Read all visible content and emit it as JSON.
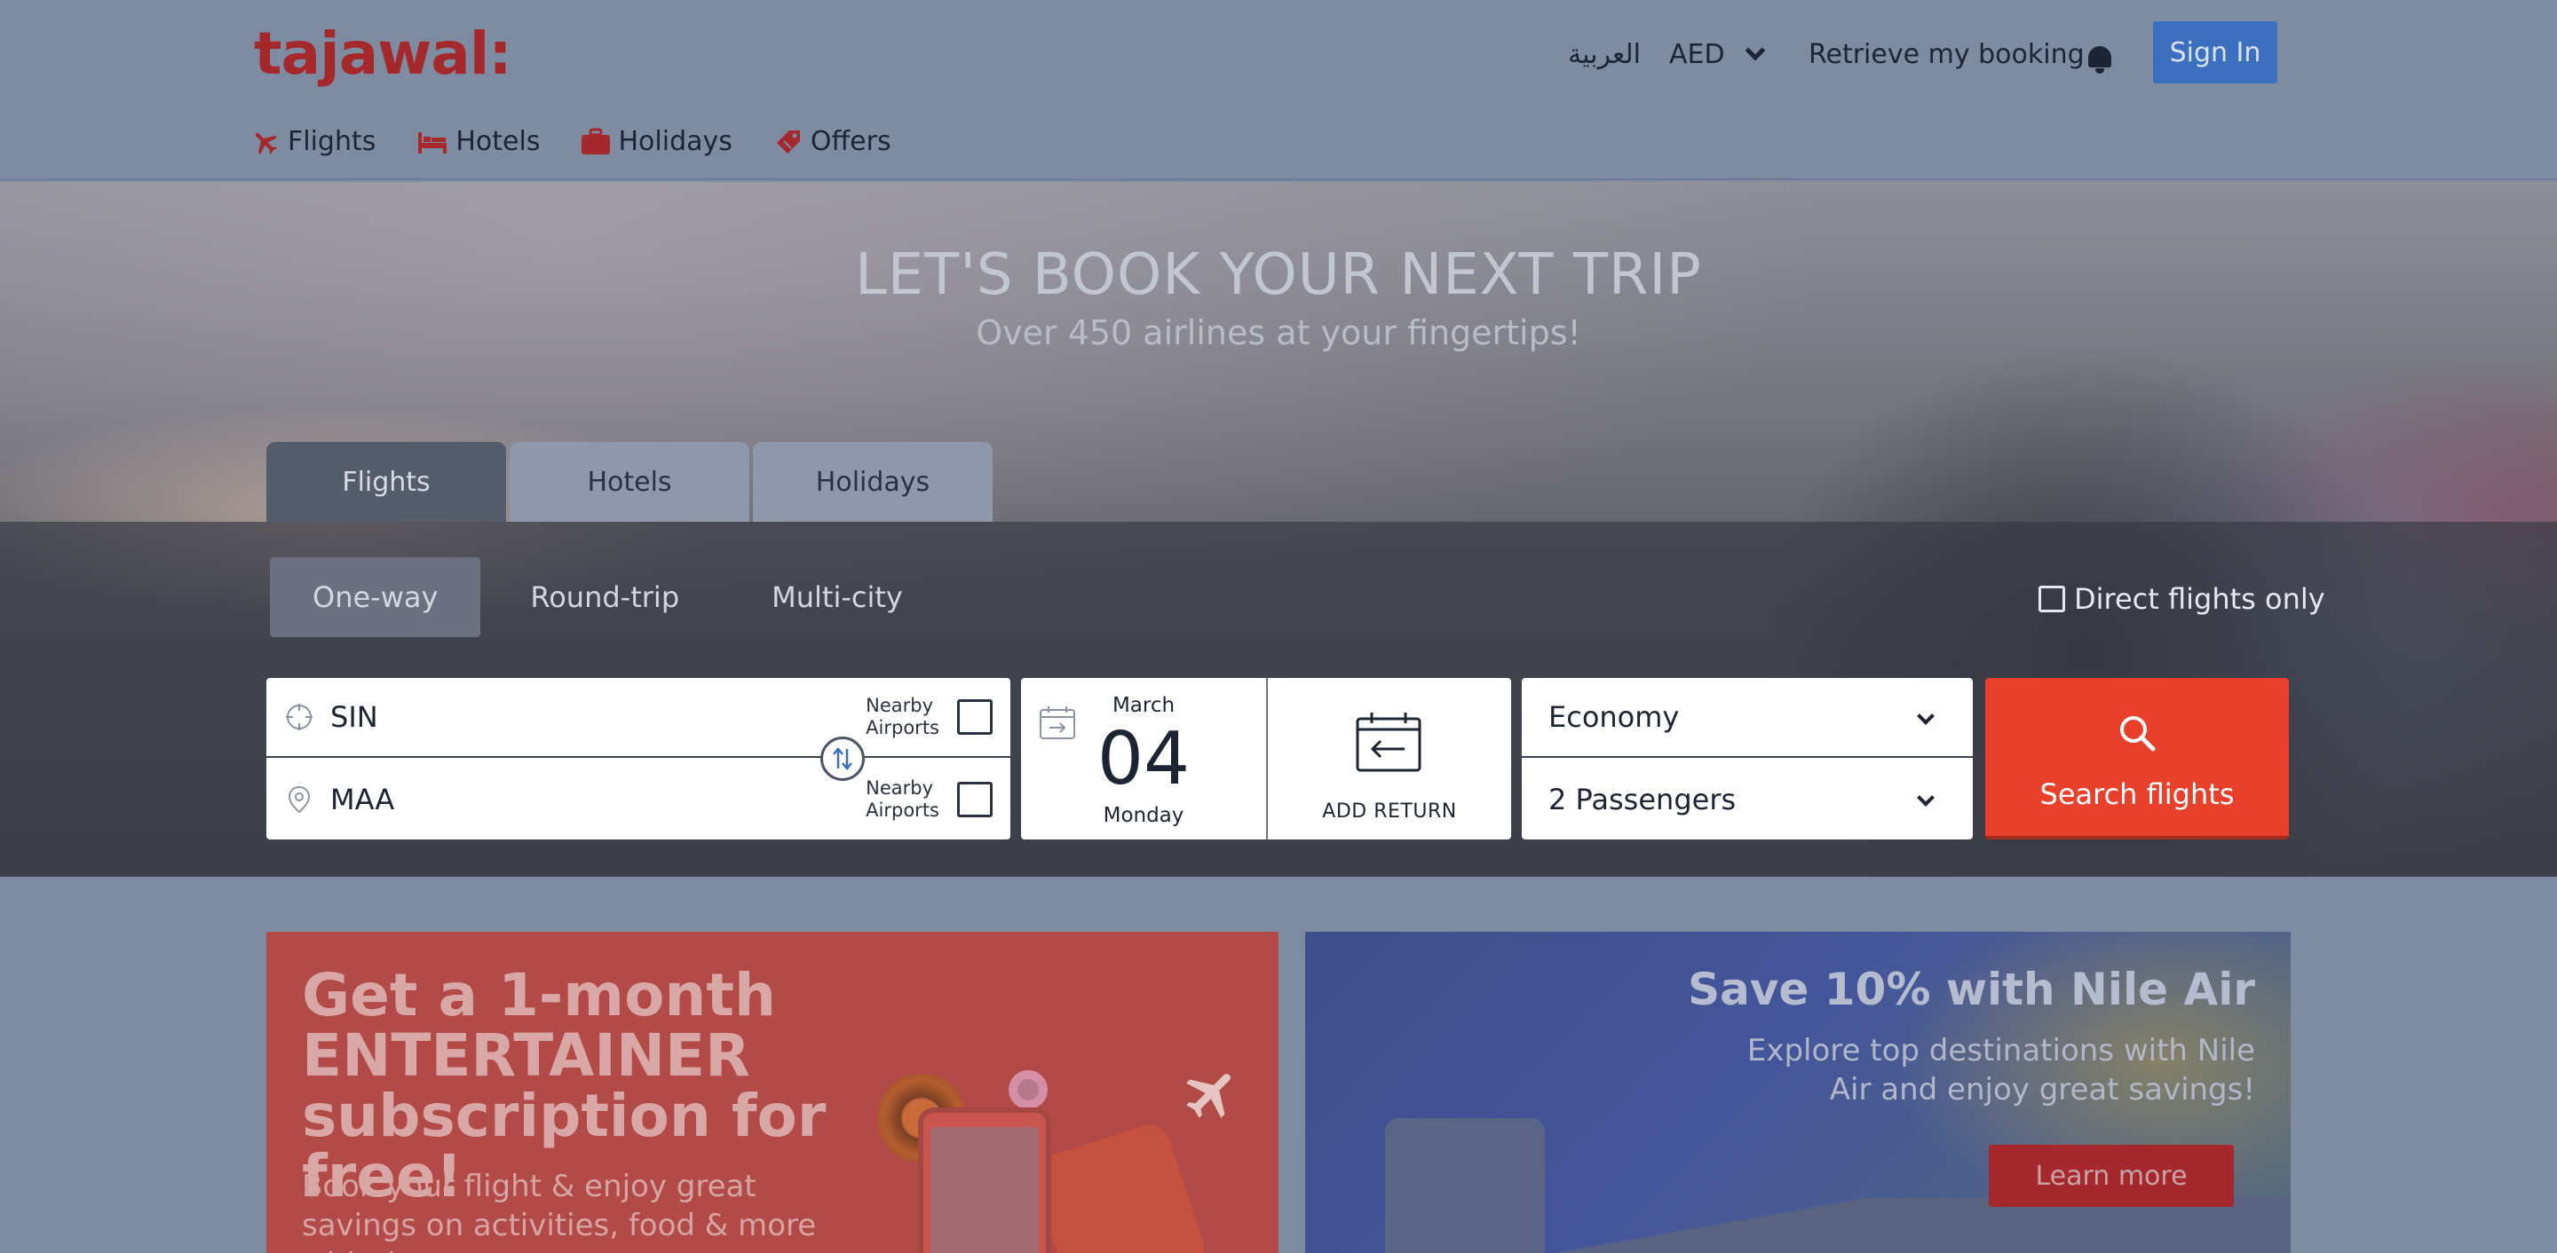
{
  "header": {
    "logo": "tajawal:",
    "arabic": "العربية",
    "currency": "AED",
    "retrieve": "Retrieve my booking",
    "signin": "Sign In"
  },
  "subnav": [
    {
      "label": "Flights",
      "icon": "plane-icon"
    },
    {
      "label": "Hotels",
      "icon": "bed-icon"
    },
    {
      "label": "Holidays",
      "icon": "suitcase-icon"
    },
    {
      "label": "Offers",
      "icon": "tag-icon"
    }
  ],
  "hero": {
    "title": "LET'S BOOK YOUR NEXT TRIP",
    "subtitle": "Over 450 airlines at your fingertips!"
  },
  "tabs": [
    "Flights",
    "Hotels",
    "Holidays"
  ],
  "trip_types": [
    "One-way",
    "Round-trip",
    "Multi-city"
  ],
  "direct_only": "Direct flights only",
  "search": {
    "origin": "SIN",
    "destination": "MAA",
    "nearby_line1": "Nearby",
    "nearby_line2": "Airports",
    "date_month": "March",
    "date_day": "04",
    "date_weekday": "Monday",
    "add_return": "ADD RETURN",
    "cabin_class": "Economy",
    "passengers": "2 Passengers",
    "button": "Search flights"
  },
  "promos": {
    "entertainer": {
      "headline": "Get a 1-month ENTERTAINER subscription for free!",
      "body": "Book your flight & enjoy great savings on activities, food & more with the"
    },
    "nileair": {
      "headline": "Save 10% with Nile Air",
      "body": "Explore top destinations with Nile Air and enjoy great savings!",
      "button": "Learn more"
    }
  },
  "colors": {
    "brand": "#a5282d",
    "signin": "#3d6fbf",
    "search_button": "#e8402a"
  }
}
